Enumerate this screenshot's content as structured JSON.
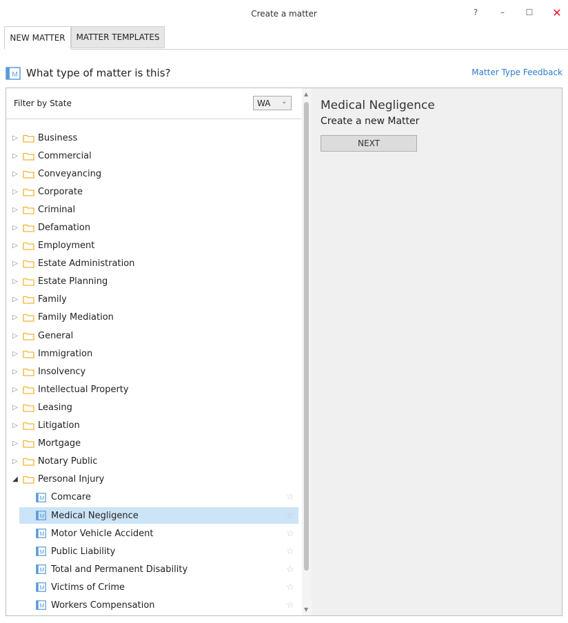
{
  "window": {
    "title": "Create a matter",
    "help": "?",
    "minimize": "–",
    "maximize": "☐",
    "close": "✕"
  },
  "tabs": [
    {
      "label": "NEW MATTER"
    },
    {
      "label": "MATTER TEMPLATES"
    }
  ],
  "header": {
    "question": "What type of matter is this?",
    "feedback_link": "Matter Type Feedback"
  },
  "filter": {
    "label": "Filter by State",
    "selected_state": "WA"
  },
  "tree": {
    "folders": [
      "Business",
      "Commercial",
      "Conveyancing",
      "Corporate",
      "Criminal",
      "Defamation",
      "Employment",
      "Estate Administration",
      "Estate Planning",
      "Family",
      "Family Mediation",
      "General",
      "Immigration",
      "Insolvency",
      "Intellectual Property",
      "Leasing",
      "Litigation",
      "Mortgage",
      "Notary Public"
    ],
    "expanded_folder": "Personal Injury",
    "children": [
      "Comcare",
      "Medical Negligence",
      "Motor Vehicle Accident",
      "Public Liability",
      "Total and Permanent Disability",
      "Victims of Crime",
      "Workers Compensation"
    ],
    "selected_child": "Medical Negligence"
  },
  "detail": {
    "title": "Medical Negligence",
    "subtitle": "Create a new Matter",
    "next_label": "NEXT"
  },
  "colors": {
    "accent": "#2b7bd0",
    "selection": "#cce4f7",
    "folder": "#f0b430",
    "close": "#e81123"
  }
}
